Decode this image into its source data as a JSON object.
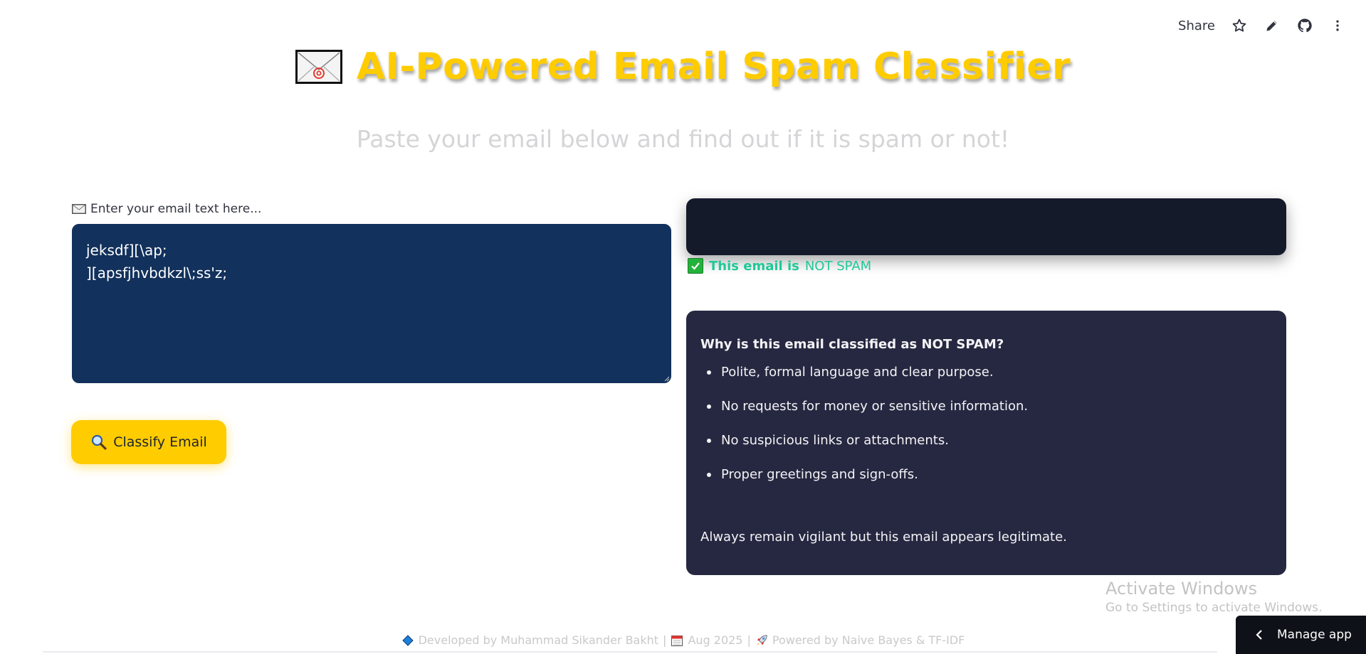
{
  "toolbar": {
    "share_label": "Share",
    "icons": [
      "star-icon",
      "pencil-icon",
      "github-icon",
      "more-vertical-icon"
    ]
  },
  "header": {
    "title": "AI-Powered Email Spam Classifier",
    "title_color": "#ffcc00",
    "subtitle": "Paste your email below and find out if it is spam or not!"
  },
  "input": {
    "label": "Enter your email text here...",
    "value": "jeksdf][\\ap;\n][apsfjhvbdkzl\\;ss'z;"
  },
  "classify_button": {
    "label": "Classify Email",
    "color": "#ffcc00"
  },
  "result": {
    "prefix": "This email is",
    "verdict": "NOT SPAM",
    "color": "#20c997"
  },
  "explanation": {
    "heading": "Why is this email classified as NOT SPAM?",
    "reasons": [
      "Polite, formal language and clear purpose.",
      "No requests for money or sensitive information.",
      "No suspicious links or attachments.",
      "Proper greetings and sign-offs."
    ],
    "conclusion": "Always remain vigilant but this email appears legitimate."
  },
  "watermark": {
    "title": "Activate Windows",
    "subtitle": "Go to Settings to activate Windows."
  },
  "footer": {
    "developer": "Developed by Muhammad Sikander Bakht",
    "date": "Aug 2025",
    "powered": "Powered by Naive Bayes & TF-IDF",
    "separator": "|"
  },
  "manage_app": {
    "label": "Manage app"
  }
}
